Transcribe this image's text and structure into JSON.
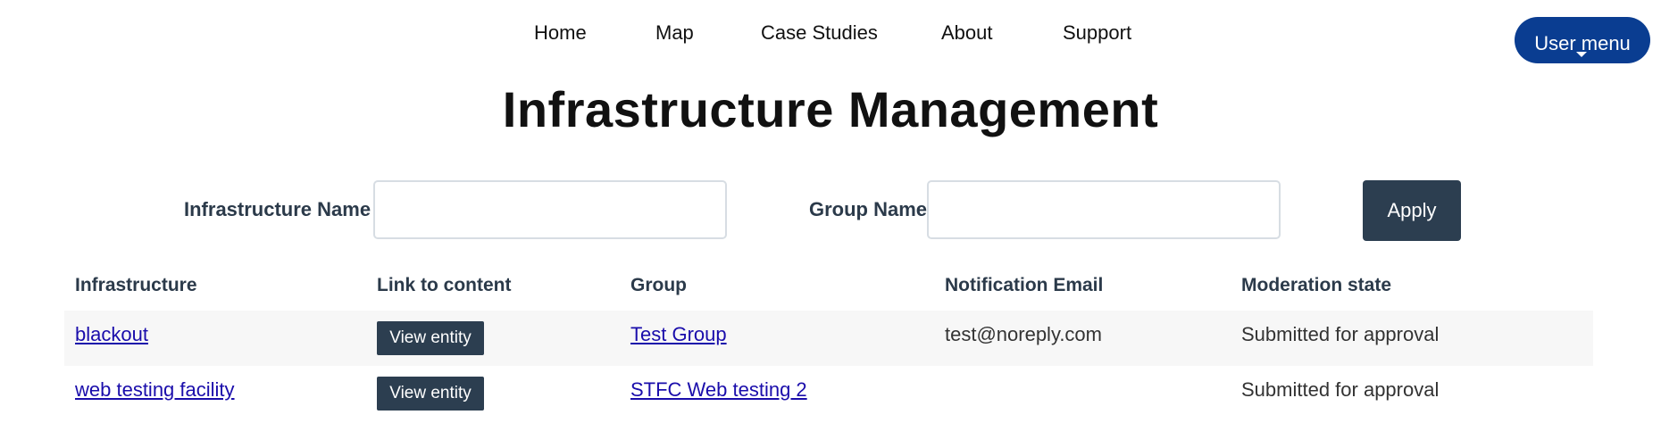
{
  "nav": {
    "items": [
      {
        "label": "Home"
      },
      {
        "label": "Map"
      },
      {
        "label": "Case Studies"
      },
      {
        "label": "About"
      },
      {
        "label": "Support"
      }
    ],
    "user_menu_label": "User menu",
    "user_menu_color": "#0a3d91"
  },
  "page": {
    "title": "Infrastructure Management"
  },
  "filters": {
    "infrastructure_name_label": "Infrastructure Name",
    "infrastructure_name_value": "",
    "group_name_label": "Group Name",
    "group_name_value": "",
    "apply_label": "Apply"
  },
  "table": {
    "headers": [
      "Infrastructure",
      "Link to content",
      "Group",
      "Notification Email",
      "Moderation state"
    ],
    "rows": [
      {
        "infrastructure": "blackout",
        "link_label": "View entity",
        "group": "Test Group",
        "notification_email": "test@noreply.com",
        "moderation_state": "Submitted for approval"
      },
      {
        "infrastructure": "web testing facility",
        "link_label": "View entity",
        "group": "STFC Web testing 2",
        "notification_email": "",
        "moderation_state": "Submitted for approval"
      }
    ]
  },
  "colors": {
    "primary_button": "#2c3e50",
    "link": "#1a0dab",
    "row_stripe": "#f7f7f7"
  }
}
